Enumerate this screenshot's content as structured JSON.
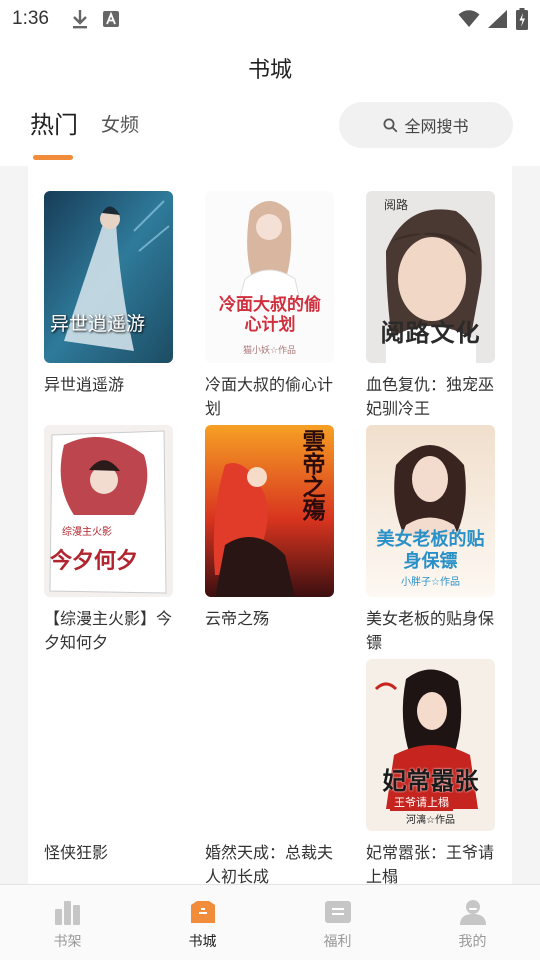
{
  "status": {
    "time": "1:36"
  },
  "header": {
    "title": "书城"
  },
  "tabs": [
    {
      "label": "热门",
      "active": true
    },
    {
      "label": "女频",
      "active": false
    }
  ],
  "search": {
    "label": "全网搜书"
  },
  "books": [
    {
      "title": "异世逍遥游",
      "cover_text": "异世逍遥游"
    },
    {
      "title": "冷面大叔的偷心计划",
      "cover_text": "冷面大叔的偷心计划",
      "cover_sub": "猫小妖☆作品"
    },
    {
      "title": "血色复仇：独宠巫妃驯冷王",
      "cover_text": "阅路文化",
      "cover_brand": "阅路"
    },
    {
      "title": "【综漫主火影】今夕知何夕",
      "cover_text": "今夕何夕",
      "cover_sub": "综漫主火影"
    },
    {
      "title": "云帝之殇",
      "cover_text": "雲帝之殤"
    },
    {
      "title": "美女老板的贴身保镖",
      "cover_text": "美女老板的贴身保镖",
      "cover_sub": "小胖子☆作品"
    },
    {
      "title": "怪侠狂影"
    },
    {
      "title": "婚然天成：总裁夫人初长成"
    },
    {
      "title": "妃常嚣张：王爷请上榻",
      "cover_text": "妃常嚣张",
      "cover_sub": "王爷请上榻",
      "cover_author": "河漓☆作品"
    }
  ],
  "bottom_nav": [
    {
      "label": "书架",
      "icon": "bookshelf-icon",
      "active": false
    },
    {
      "label": "书城",
      "icon": "store-icon",
      "active": true
    },
    {
      "label": "福利",
      "icon": "welfare-icon",
      "active": false
    },
    {
      "label": "我的",
      "icon": "profile-icon",
      "active": false
    }
  ],
  "colors": {
    "accent": "#f08c3a",
    "inactive": "#c6c6c6"
  }
}
